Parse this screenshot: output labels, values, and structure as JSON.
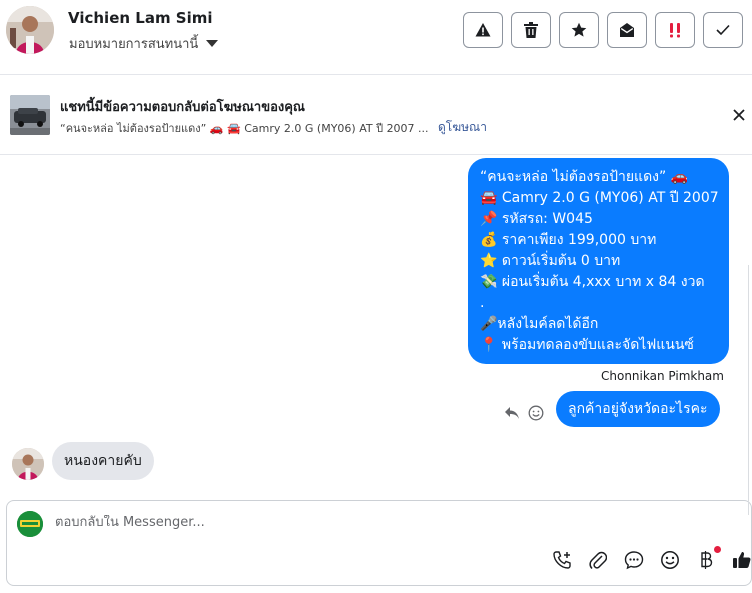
{
  "header": {
    "contact_name": "Vichien Lam Simi",
    "assign_label": "มอบหมายการสนทนานี้",
    "actions": [
      {
        "icon": "warning-icon"
      },
      {
        "icon": "trash-icon"
      },
      {
        "icon": "star-icon"
      },
      {
        "icon": "mark-unread-icon"
      },
      {
        "icon": "priority-icon"
      },
      {
        "icon": "check-icon"
      }
    ]
  },
  "ad": {
    "title": "แชทนี้มีข้อความตอบกลับต่อโฆษณาของคุณ",
    "subtitle": "“คนจะหล่อ ไม่ต้องรอป้ายแดง” 🚗 🚘 Camry 2.0 G (MY06) AT ปี 2007 ...",
    "link": "ดูโฆษณา"
  },
  "messages": {
    "outgoing_lines": [
      "“คนจะหล่อ ไม่ต้องรอป้ายแดง” 🚗",
      "🚘 Camry 2.0 G (MY06) AT ปี 2007",
      "📌 รหัสรถ: W045",
      "💰 ราคาเพียง 199,000 บาท",
      "⭐ ดาวน์เริ่มต้น 0 บาท",
      "💸 ผ่อนเริ่มต้น 4,xxx บาท x 84 งวด",
      ".",
      "🎤หลังไมค์ลดได้อีก",
      "📍 พร้อมทดลองขับและจัดไฟแนนซ์"
    ],
    "sender": "Chonnikan Pimkham",
    "outgoing_2": "ลูกค้าอยู่จังหวัดอะไรคะ",
    "incoming": "หนองคายคับ"
  },
  "composer": {
    "placeholder": "ตอบกลับใน Messenger...",
    "tools": [
      "add-call-icon",
      "attachment-icon",
      "quick-reply-icon",
      "emoji-icon",
      "payment-icon",
      "like-icon"
    ]
  },
  "colors": {
    "accent": "#0a7cff",
    "incoming_bubble": "#e4e6eb",
    "priority_red": "#e41e3f"
  }
}
